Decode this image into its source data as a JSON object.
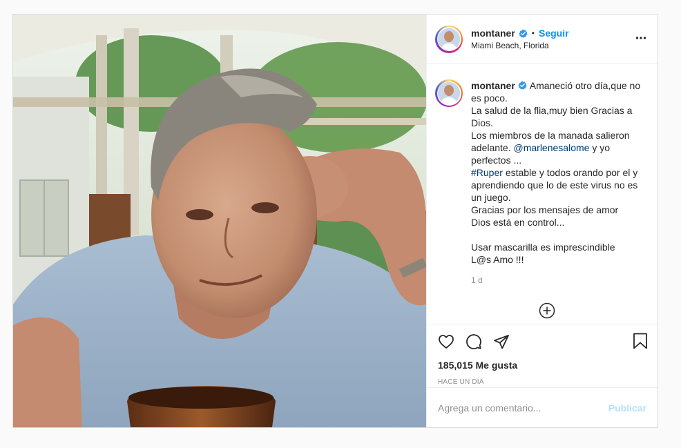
{
  "post": {
    "image_alt": "Selfie de montaner",
    "author": {
      "username": "montaner",
      "verified": true,
      "follow_label": "Seguir",
      "separator": "•",
      "location": "Miami Beach, Florida"
    },
    "more_icon": "more-horizontal-icon",
    "caption": {
      "lines": [
        "Amaneció otro día,que no es poco.",
        "La salud de la flia,muy bien Gracias a Dios.",
        "Los miembros de la manada salieron adelante.",
        "@marlenesalome",
        "y yo perfectos ...",
        "#Ruper",
        "estable y todos orando por el y aprendiendo que lo de este virus no es un juego.",
        "Gracias por los mensajes de amor",
        "Dios está en control...",
        "",
        "Usar mascarilla es imprescindible",
        "L@s Amo !!!"
      ],
      "time_ago": "1 d"
    },
    "load_more_icon": "plus-circle-icon",
    "actions": {
      "like_icon": "heart-icon",
      "comment_icon": "comment-icon",
      "share_icon": "send-icon",
      "save_icon": "bookmark-icon"
    },
    "likes": "185,015 Me gusta",
    "date": "HACE UN DÍA",
    "comment": {
      "placeholder": "Agrega un comentario...",
      "value": "",
      "publish_label": "Publicar"
    }
  },
  "colors": {
    "accent": "#0095f6",
    "verified": "#3897f0",
    "link": "#00376b",
    "publish_disabled": "#b2dffc",
    "muted": "#8e8e8e"
  }
}
